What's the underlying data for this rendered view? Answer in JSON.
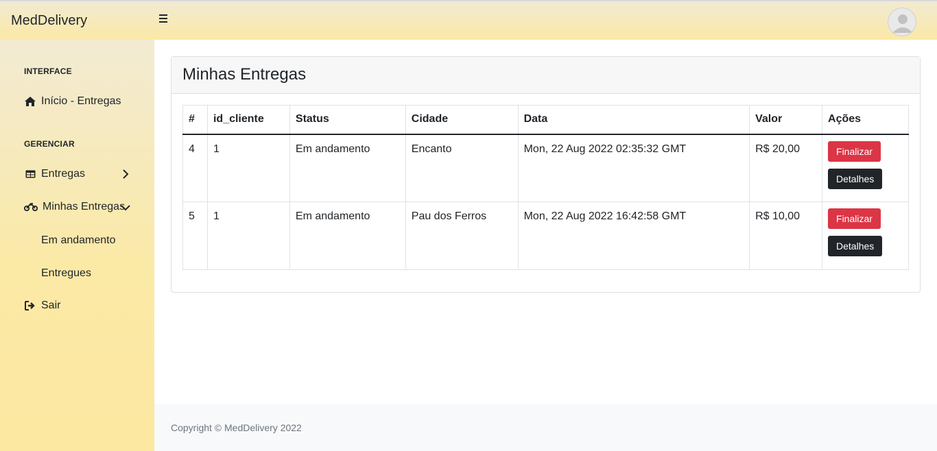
{
  "app": {
    "brand": "MedDelivery"
  },
  "sidebar": {
    "heading_interface": "INTERFACE",
    "inicio": "Início - Entregas",
    "heading_gerenciar": "GERENCIAR",
    "entregas": "Entregas",
    "minhas_entregas": "Minhas Entregas",
    "em_andamento": "Em andamento",
    "entregues": "Entregues",
    "sair": "Sair"
  },
  "main": {
    "title": "Minhas Entregas",
    "table": {
      "headers": [
        "#",
        "id_cliente",
        "Status",
        "Cidade",
        "Data",
        "Valor",
        "Ações"
      ],
      "rows": [
        {
          "id": "4",
          "cliente": "1",
          "status": "Em andamento",
          "cidade": "Encanto",
          "data": "Mon, 22 Aug 2022 02:35:32 GMT",
          "valor": "R$ 20,00",
          "finalizar": "Finalizar",
          "detalhes": "Detalhes"
        },
        {
          "id": "5",
          "cliente": "1",
          "status": "Em andamento",
          "cidade": "Pau dos Ferros",
          "data": "Mon, 22 Aug 2022 16:42:58 GMT",
          "valor": "R$ 10,00",
          "finalizar": "Finalizar",
          "detalhes": "Detalhes"
        }
      ]
    }
  },
  "footer": {
    "text": "Copyright © MedDelivery 2022"
  },
  "colors": {
    "danger": "#dc3545",
    "dark": "#212529",
    "topbar": "#fbe9a6"
  },
  "icons": [
    "menu-icon",
    "avatar-icon",
    "home-icon",
    "table-icon",
    "chevron-right-icon",
    "motorcycle-icon",
    "chevron-down-icon",
    "sign-out-icon"
  ]
}
